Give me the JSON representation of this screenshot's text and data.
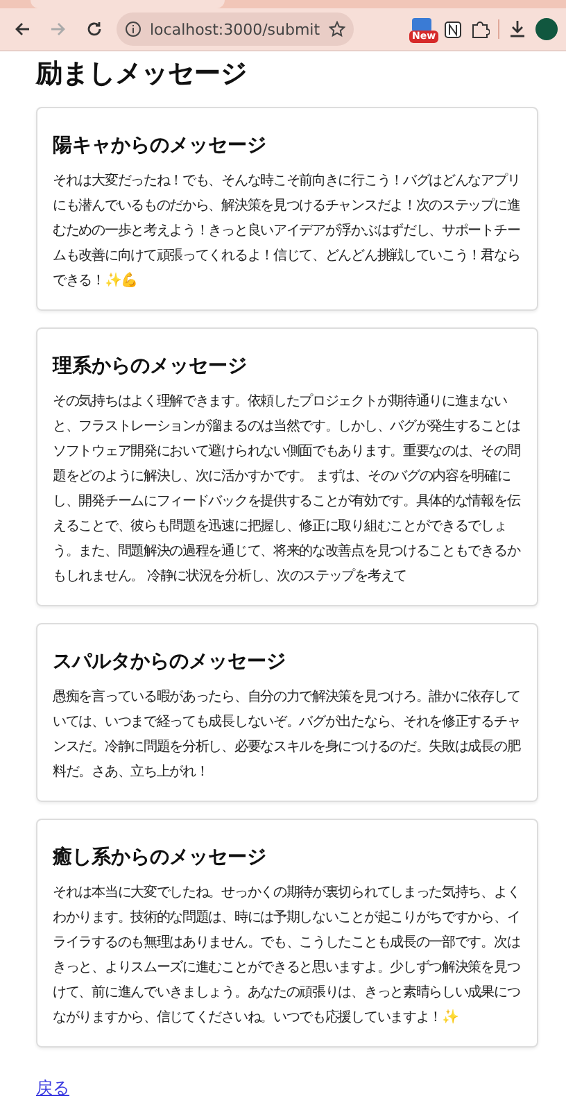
{
  "browser": {
    "url": "localhost:3000/submit",
    "extension_badge": "New"
  },
  "page_title": "励ましメッセージ",
  "messages": [
    {
      "title": "陽キャからのメッセージ",
      "body": "それは大変だったね！でも、そんな時こそ前向きに行こう！バグはどんなアプリにも潜んでいるものだから、解決策を見つけるチャンスだよ！次のステップに進むための一歩と考えよう！きっと良いアイデアが浮かぶはずだし、サポートチームも改善に向けて頑張ってくれるよ！信じて、どんどん挑戦していこう！君ならできる！✨💪"
    },
    {
      "title": "理系からのメッセージ",
      "body": "その気持ちはよく理解できます。依頼したプロジェクトが期待通りに進まないと、フラストレーションが溜まるのは当然です。しかし、バグが発生することはソフトウェア開発において避けられない側面でもあります。重要なのは、その問題をどのように解決し、次に活かすかです。 まずは、そのバグの内容を明確にし、開発チームにフィードバックを提供することが有効です。具体的な情報を伝えることで、彼らも問題を迅速に把握し、修正に取り組むことができるでしょう。また、問題解決の過程を通じて、将来的な改善点を見つけることもできるかもしれません。 冷静に状況を分析し、次のステップを考えて"
    },
    {
      "title": "スパルタからのメッセージ",
      "body": "愚痴を言っている暇があったら、自分の力で解決策を見つけろ。誰かに依存していては、いつまで経っても成長しないぞ。バグが出たなら、それを修正するチャンスだ。冷静に問題を分析し、必要なスキルを身につけるのだ。失敗は成長の肥料だ。さあ、立ち上がれ！"
    },
    {
      "title": "癒し系からのメッセージ",
      "body": "それは本当に大変でしたね。せっかくの期待が裏切られてしまった気持ち、よくわかります。技術的な問題は、時には予期しないことが起こりがちですから、イライラするのも無理はありません。でも、こうしたことも成長の一部です。次はきっと、よりスムーズに進むことができると思いますよ。少しずつ解決策を見つけて、前に進んでいきましょう。あなたの頑張りは、きっと素晴らしい成果につながりますから、信じてくださいね。いつでも応援していますよ！✨"
    }
  ],
  "back_link": "戻る"
}
